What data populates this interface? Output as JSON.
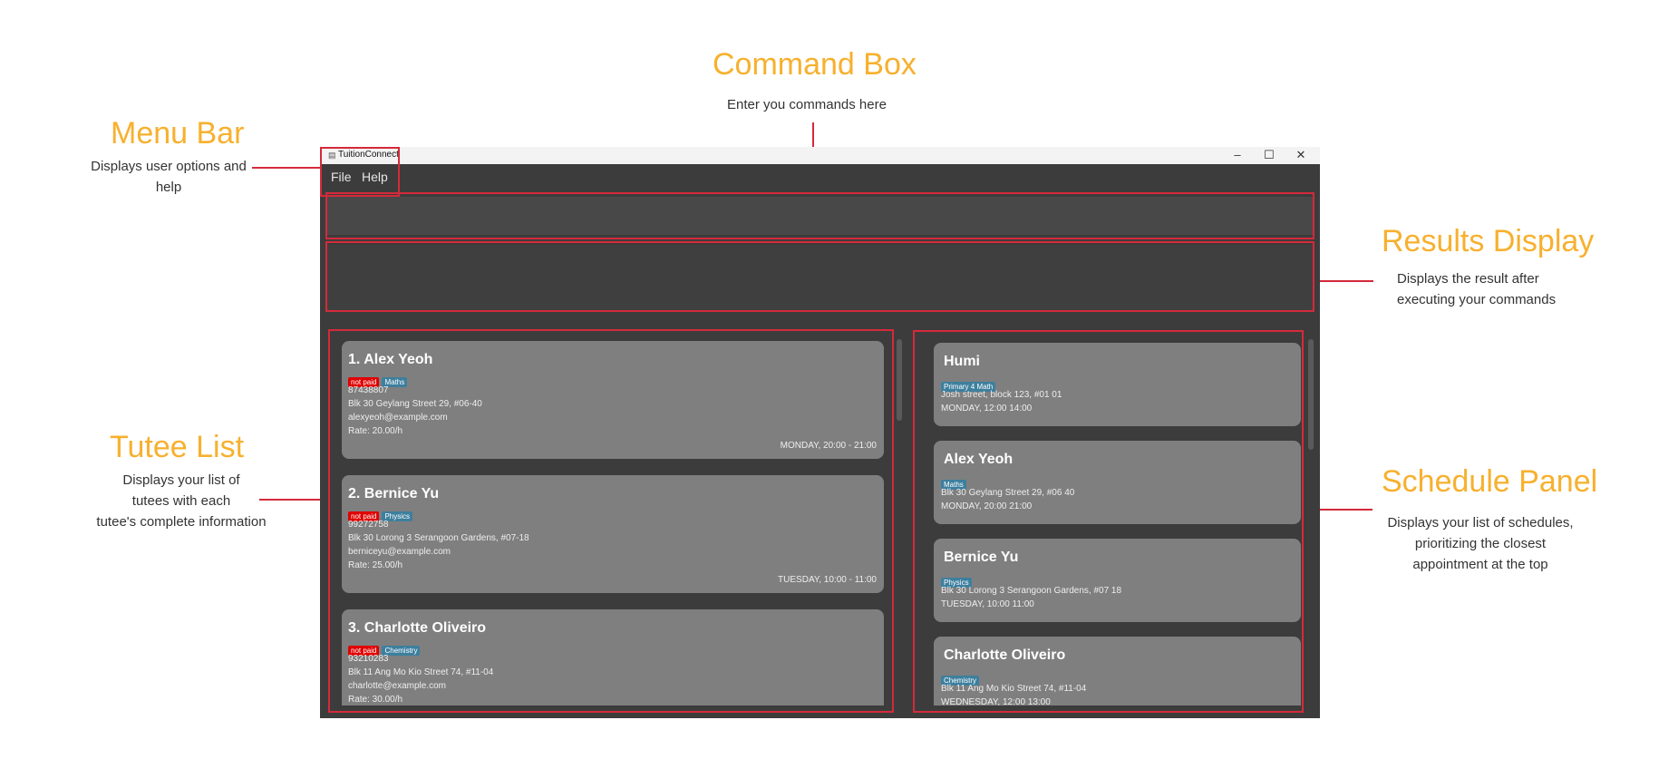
{
  "annotations": {
    "command_box": {
      "title": "Command Box",
      "desc": "Enter you commands here"
    },
    "menu_bar": {
      "title": "Menu Bar",
      "desc_lines": [
        "Displays user options and",
        "help"
      ]
    },
    "results_display": {
      "title": "Results Display",
      "desc_lines": [
        "Displays the result after",
        "executing your commands"
      ]
    },
    "tutee_list": {
      "title": "Tutee List",
      "desc_lines": [
        "Displays your list of",
        "tutees with each",
        "tutee's complete information"
      ]
    },
    "schedule_panel": {
      "title": "Schedule Panel",
      "desc_lines": [
        "Displays your list of schedules,",
        "prioritizing the closest",
        "appointment at the top"
      ]
    }
  },
  "window": {
    "title": "TuitionConnect",
    "minimize_glyph": "–",
    "maximize_glyph": "☐",
    "close_glyph": "✕"
  },
  "menu": {
    "file": "File",
    "help": "Help"
  },
  "tutees": [
    {
      "name": "1.  Alex Yeoh",
      "paid": "not paid",
      "subject": "Maths",
      "phone": "87438807",
      "address": "Blk 30 Geylang Street 29, #06-40",
      "email": "alexyeoh@example.com",
      "rate": "Rate: 20.00/h",
      "schedule": "MONDAY, 20:00 - 21:00"
    },
    {
      "name": "2.  Bernice Yu",
      "paid": "not paid",
      "subject": "Physics",
      "phone": "99272758",
      "address": "Blk 30 Lorong 3 Serangoon Gardens, #07-18",
      "email": "berniceyu@example.com",
      "rate": "Rate: 25.00/h",
      "schedule": "TUESDAY, 10:00 - 11:00"
    },
    {
      "name": "3.  Charlotte Oliveiro",
      "paid": "not paid",
      "subject": "Chemistry",
      "phone": "93210283",
      "address": "Blk 11 Ang Mo Kio Street 74, #11-04",
      "email": "charlotte@example.com",
      "rate": "Rate: 30.00/h",
      "schedule": ""
    }
  ],
  "schedules": [
    {
      "name": "Humi",
      "subject": "Primary 4 Math",
      "address": "Josh street, block 123, #01 01",
      "time": "MONDAY, 12:00   14:00"
    },
    {
      "name": "Alex Yeoh",
      "subject": "Maths",
      "address": "Blk 30 Geylang Street 29, #06 40",
      "time": "MONDAY, 20:00   21:00"
    },
    {
      "name": "Bernice Yu",
      "subject": "Physics",
      "address": "Blk 30 Lorong 3 Serangoon Gardens, #07 18",
      "time": "TUESDAY, 10:00   11:00"
    },
    {
      "name": "Charlotte Oliveiro",
      "subject": "Chemistry",
      "address": "Blk 11 Ang Mo Kio Street 74, #11-04",
      "time": "WEDNESDAY, 12:00   13:00"
    }
  ],
  "colors": {
    "accent_annotation": "#F7B02E",
    "highlight_border": "#d42a3a",
    "paid_tag": "#e00000",
    "subject_tag": "#3d7f9e"
  }
}
